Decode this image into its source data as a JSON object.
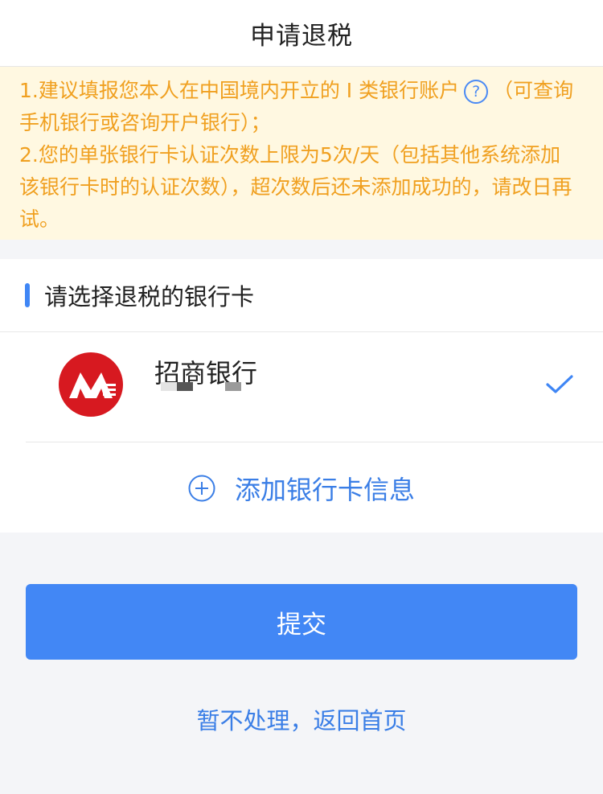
{
  "header": {
    "title": "申请退税"
  },
  "notice": {
    "line1_before_icon": "1.建议填报您本人在中国境内开立的 I 类银行账户",
    "help_icon_glyph": "?",
    "line1_after_icon": "（可查询手机银行或咨询开户银行）；",
    "line2": "2.您的单张银行卡认证次数上限为5次/天（包括其他系统添加该银行卡时的认证次数），超次数后还未添加成功的，请改日再试。",
    "text_color": "#f0a020",
    "background": "#fff8e1"
  },
  "section": {
    "title": "请选择退税的银行卡"
  },
  "bank": {
    "name": "招商银行",
    "logo_icon": "cmb-logo-icon",
    "selected": true,
    "check_icon": "checkmark-icon"
  },
  "add_card": {
    "label": "添加银行卡信息",
    "icon": "plus-circle-icon"
  },
  "submit": {
    "label": "提交",
    "color": "#4287f5"
  },
  "back": {
    "label": "暂不处理，返回首页"
  }
}
